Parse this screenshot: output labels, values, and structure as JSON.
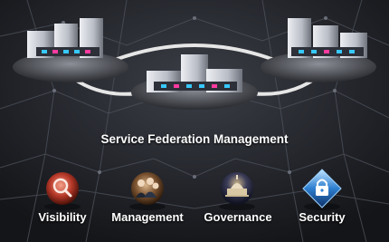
{
  "title": "Service Federation Management",
  "icons": [
    {
      "label": "Visibility",
      "icon": "magnifier-icon"
    },
    {
      "label": "Management",
      "icon": "people-icon"
    },
    {
      "label": "Governance",
      "icon": "capitol-icon"
    },
    {
      "label": "Security",
      "icon": "padlock-icon"
    }
  ],
  "colors": {
    "background": "#1b1d22",
    "text": "#ffffff"
  }
}
